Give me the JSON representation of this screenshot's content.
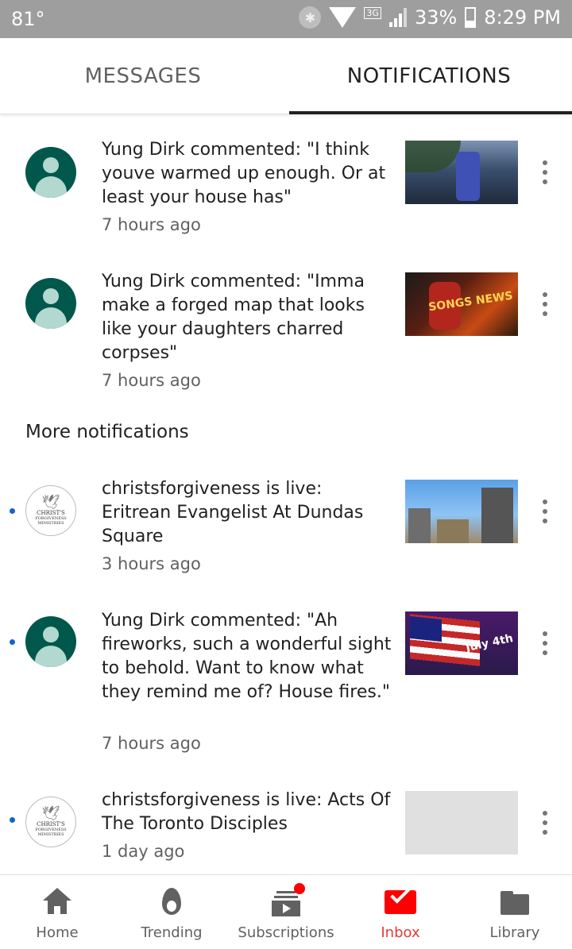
{
  "status_bar": {
    "temperature": "81°",
    "network": "3G",
    "battery": "33%",
    "time": "8:29 PM"
  },
  "tabs": [
    {
      "label": "MESSAGES",
      "active": false
    },
    {
      "label": "NOTIFICATIONS",
      "active": true
    }
  ],
  "notifications": [
    {
      "text": "Yung Dirk commented: \"I think youve warmed up enough. Or at least your house has\"",
      "time": "7 hours ago",
      "unread": false,
      "avatar": "default-avatar-icon"
    },
    {
      "text": "Yung Dirk commented: \"Imma make a forged map that looks like your daughters charred corpses\"",
      "time": "7 hours ago",
      "unread": false,
      "avatar": "default-avatar-icon"
    }
  ],
  "more_section_title": "More notifications",
  "more_notifications": [
    {
      "text": "christsforgiveness is live: Eritrean Evangelist At Dundas Square",
      "time": "3 hours ago",
      "unread": true,
      "avatar": "christs-forgiveness-logo"
    },
    {
      "text": "Yung Dirk commented: \"Ah fireworks, such a wonderful sight to behold. Want to know what they remind me of? House fires.\"",
      "time": "7 hours ago",
      "unread": true,
      "avatar": "default-avatar-icon"
    },
    {
      "text": "christsforgiveness is live: Acts Of The Toronto Disciples",
      "time": "1 day ago",
      "unread": true,
      "avatar": "christs-forgiveness-logo"
    }
  ],
  "logo_text": {
    "line1": "CHRIST'S",
    "line2": "FORGIVENESS",
    "line3": "MINISTRIES"
  },
  "thumb_text": {
    "t2": "SONGS NEWS",
    "t4": "July 4th"
  },
  "bottom_nav": [
    {
      "label": "Home",
      "icon": "home-icon",
      "active": false
    },
    {
      "label": "Trending",
      "icon": "fire-icon",
      "active": false
    },
    {
      "label": "Subscriptions",
      "icon": "subscriptions-icon",
      "active": false
    },
    {
      "label": "Inbox",
      "icon": "inbox-icon",
      "active": true
    },
    {
      "label": "Library",
      "icon": "library-folder-icon",
      "active": false
    }
  ],
  "colors": {
    "status_bar": "#9e9e9e",
    "avatar_bg": "#00574b",
    "unread_dot": "#1565c0",
    "active_accent": "#ff0000"
  }
}
